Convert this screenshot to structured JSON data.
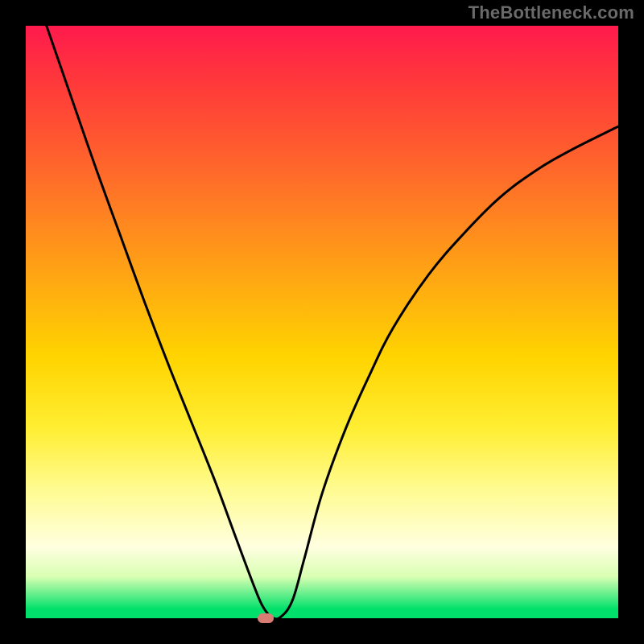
{
  "watermark": "TheBottleneck.com",
  "chart_data": {
    "type": "line",
    "title": "",
    "xlabel": "",
    "ylabel": "",
    "xlim": [
      0,
      1
    ],
    "ylim": [
      0,
      1
    ],
    "axes_hidden": true,
    "grid": false,
    "background_gradient": {
      "stops": [
        {
          "pos": 0.0,
          "color": "#ff1a4d"
        },
        {
          "pos": 0.25,
          "color": "#ff6a2a"
        },
        {
          "pos": 0.56,
          "color": "#ffd400"
        },
        {
          "pos": 0.88,
          "color": "#ffffe0"
        },
        {
          "pos": 1.0,
          "color": "#00e06a"
        }
      ]
    },
    "series": [
      {
        "name": "bottleneck-curve",
        "x": [
          0.035,
          0.08,
          0.12,
          0.16,
          0.2,
          0.24,
          0.28,
          0.32,
          0.355,
          0.385,
          0.4,
          0.415,
          0.43,
          0.45,
          0.47,
          0.5,
          0.54,
          0.58,
          0.62,
          0.68,
          0.74,
          0.8,
          0.86,
          0.92,
          1.0
        ],
        "values": [
          1.0,
          0.87,
          0.755,
          0.645,
          0.535,
          0.43,
          0.33,
          0.23,
          0.135,
          0.055,
          0.02,
          0.002,
          0.002,
          0.03,
          0.1,
          0.21,
          0.32,
          0.41,
          0.49,
          0.58,
          0.65,
          0.71,
          0.755,
          0.79,
          0.83
        ]
      }
    ],
    "annotations": [
      {
        "name": "marker",
        "shape": "rounded-rect",
        "x": 0.405,
        "y": 0.0,
        "color": "#d87c74"
      }
    ]
  }
}
